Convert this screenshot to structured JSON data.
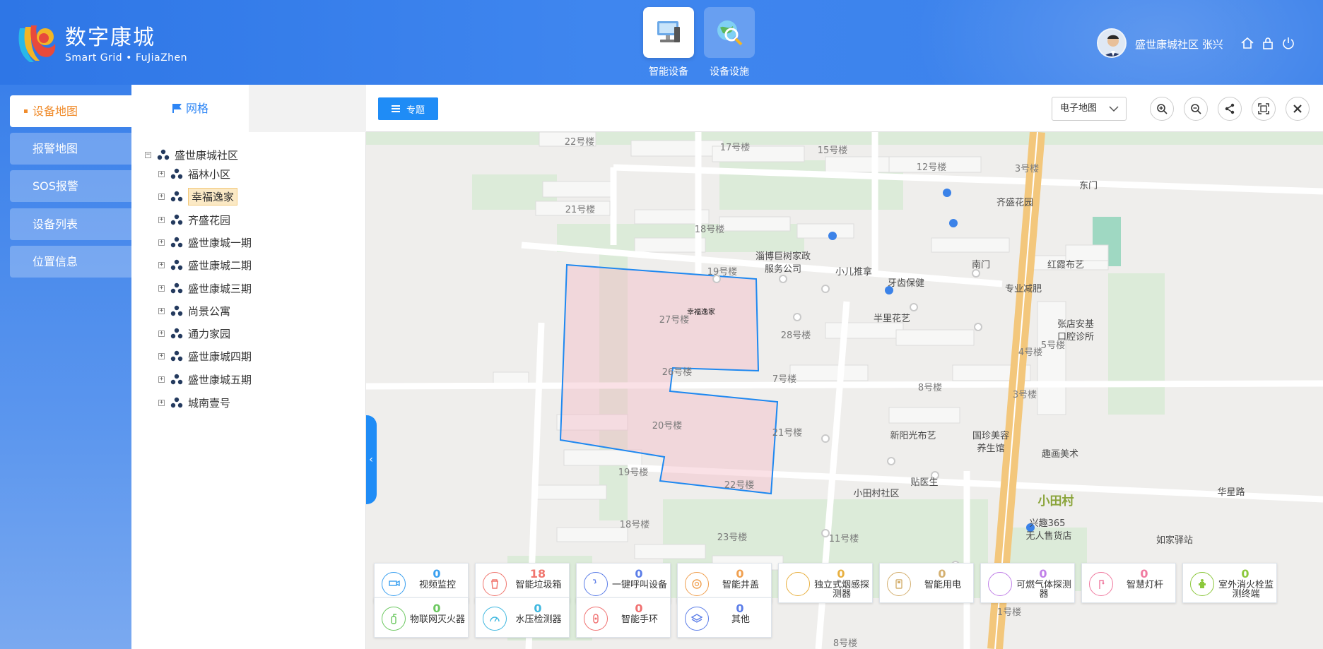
{
  "brand": {
    "title": "数字康城",
    "subtitle": "Smart Grid • FuJiaZhen"
  },
  "topnav": [
    {
      "label": "智能设备",
      "icon": "computer-icon"
    },
    {
      "label": "设备设施",
      "icon": "globe-search-icon"
    }
  ],
  "user": {
    "name": "盛世康城社区 张兴"
  },
  "left_nav": [
    "设备地图",
    "报警地图",
    "SOS报警",
    "设备列表",
    "位置信息"
  ],
  "tree": {
    "tab": "网格",
    "root": "盛世康城社区",
    "children": [
      "福林小区",
      "幸福逸家",
      "齐盛花园",
      "盛世康城一期",
      "盛世康城二期",
      "盛世康城三期",
      "尚景公寓",
      "通力家园",
      "盛世康城四期",
      "盛世康城五期",
      "城南壹号"
    ],
    "selected": "幸福逸家"
  },
  "toolbar": {
    "topic_label": "专题",
    "map_type": "电子地图"
  },
  "map": {
    "area_label": "幸福逸家",
    "labels": [
      "22号楼",
      "17号楼",
      "15号楼",
      "12号楼",
      "3号楼",
      "东门",
      "21号楼",
      "齐盛花园",
      "18号楼",
      "淄博巨树家政",
      "服务公司",
      "小儿推拿",
      "牙齿保健",
      "南门",
      "红霞布艺",
      "专业减肥",
      "19号楼",
      "27号楼",
      "28号楼",
      "半里花艺",
      "张店安基",
      "口腔诊所",
      "5号楼",
      "4号楼",
      "26号楼",
      "7号楼",
      "8号楼",
      "3号楼",
      "20号楼",
      "21号楼",
      "新阳光布艺",
      "国珍美容",
      "养生馆",
      "趣画美术",
      "19号楼",
      "22号楼",
      "贴医生",
      "小田村社区",
      "小田村",
      "兴趣365",
      "无人售货店",
      "华星路",
      "如家驿站",
      "18号楼",
      "23号楼",
      "11号楼",
      "1号楼",
      "8号楼"
    ]
  },
  "devices": [
    {
      "name": "视频监控",
      "count": "0",
      "color": "#3aa0f0",
      "icon": "camera-icon"
    },
    {
      "name": "智能垃圾箱",
      "count": "18",
      "color": "#f0766e",
      "icon": "trash-icon"
    },
    {
      "name": "一键呼叫设备",
      "count": "0",
      "color": "#5b7de8",
      "icon": "phone-icon"
    },
    {
      "name": "智能井盖",
      "count": "0",
      "color": "#f0a050",
      "icon": "manhole-icon"
    },
    {
      "name": "独立式烟感探测器",
      "count": "0",
      "color": "#e8b040",
      "icon": "smoke-icon"
    },
    {
      "name": "智能用电",
      "count": "0",
      "color": "#d4b070",
      "icon": "power-icon"
    },
    {
      "name": "可燃气体探测器",
      "count": "0",
      "color": "#c080e8",
      "icon": "gas-icon"
    },
    {
      "name": "智慧灯杆",
      "count": "0",
      "color": "#f07aa0",
      "icon": "lamp-icon"
    },
    {
      "name": "室外消火栓监测终端",
      "count": "0",
      "color": "#8cc83c",
      "icon": "hydrant-icon"
    },
    {
      "name": "物联网灭火器",
      "count": "0",
      "color": "#6cc860",
      "icon": "extinguisher-icon"
    },
    {
      "name": "水压检测器",
      "count": "0",
      "color": "#40b8e0",
      "icon": "gauge-icon"
    },
    {
      "name": "智能手环",
      "count": "0",
      "color": "#f07070",
      "icon": "band-icon"
    },
    {
      "name": "其他",
      "count": "0",
      "color": "#5b7de8",
      "icon": "layers-icon"
    }
  ]
}
